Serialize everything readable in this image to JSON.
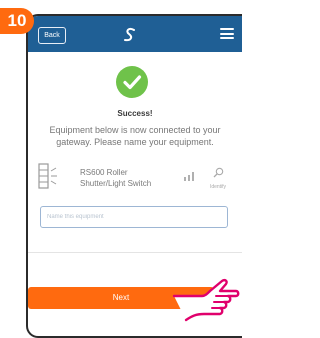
{
  "step": {
    "number": "10"
  },
  "topbar": {
    "back_label": "Back"
  },
  "status": {
    "title": "Success!",
    "message": "Equipment below is now connected to your gateway. Please name your equipment."
  },
  "device": {
    "name": "RS600 Roller Shutter/Light Switch",
    "identify_label": "Identify"
  },
  "name_input": {
    "placeholder": "Name this equipment",
    "value": ""
  },
  "next_button": {
    "label": "Next"
  },
  "colors": {
    "accent": "#ff6a0f",
    "header": "#1f5f95",
    "success": "#6fc24a",
    "input_border": "#9db6d4"
  },
  "icons": [
    "logo-icon",
    "menu-icon",
    "check-icon",
    "shutter-icon",
    "signal-icon",
    "identify-icon",
    "hand-pointer-icon"
  ]
}
